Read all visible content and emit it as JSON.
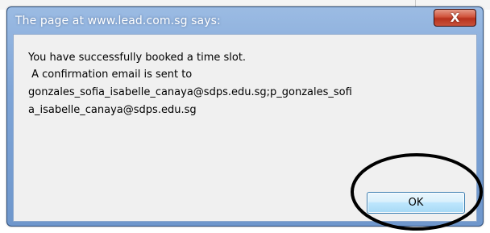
{
  "dialog": {
    "title": "The page at www.lead.com.sg says:",
    "close_icon": "close-icon",
    "close_glyph": "X",
    "message_lines": [
      "You have successfully booked a time slot.",
      " A confirmation email is sent to",
      "gonzales_sofia_isabelle_canaya@sdps.edu.sg;p_gonzales_sofi",
      "a_isabelle_canaya@sdps.edu.sg"
    ],
    "ok_label": "OK"
  },
  "colors": {
    "title_bar": "#7ea4d6",
    "close_button": "#c8513b",
    "content_bg": "#f0f0f0",
    "ok_button": "#bee6fd",
    "annotation_circle": "#000000"
  }
}
